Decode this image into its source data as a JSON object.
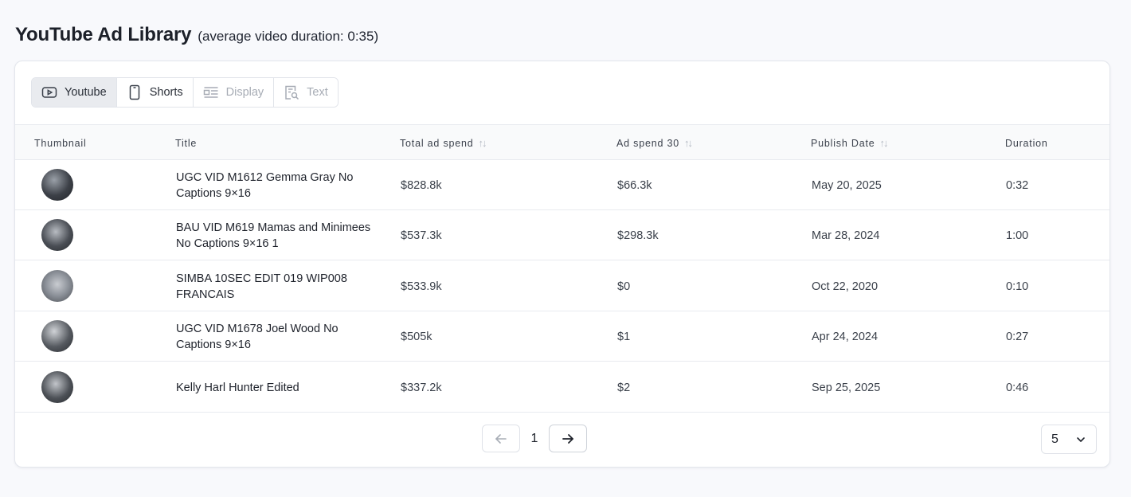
{
  "page": {
    "title": "YouTube Ad Library",
    "subtitle": "(average video duration: 0:35)"
  },
  "tabs": [
    {
      "label": "Youtube",
      "icon": "play-icon",
      "state": "active"
    },
    {
      "label": "Shorts",
      "icon": "phone-icon",
      "state": "normal"
    },
    {
      "label": "Display",
      "icon": "display-icon",
      "state": "disabled"
    },
    {
      "label": "Text",
      "icon": "text-search-icon",
      "state": "disabled"
    }
  ],
  "columns": {
    "thumbnail": "Thumbnail",
    "title": "Title",
    "total_spend": "Total ad spend",
    "spend_30": "Ad spend 30",
    "publish_date": "Publish Date",
    "duration": "Duration"
  },
  "rows": [
    {
      "title": "UGC VID M1612 Gemma Gray No Captions 9×16",
      "total_spend": "$828.8k",
      "spend_30": "$66.3k",
      "publish_date": "May 20, 2025",
      "duration": "0:32",
      "thumb_color": "#3c4047"
    },
    {
      "title": "BAU VID M619 Mamas and Minimees No Captions 9×16 1",
      "total_spend": "$537.3k",
      "spend_30": "$298.3k",
      "publish_date": "Mar 28, 2024",
      "duration": "1:00",
      "thumb_color": "#4a4e55"
    },
    {
      "title": "SIMBA 10SEC EDIT 019 WIP008 FRANCAIS",
      "total_spend": "$533.9k",
      "spend_30": "$0",
      "publish_date": "Oct 22, 2020",
      "duration": "0:10",
      "thumb_color": "#8a8f97"
    },
    {
      "title": "UGC VID M1678 Joel Wood No Captions 9×16",
      "total_spend": "$505k",
      "spend_30": "$1",
      "publish_date": "Apr 24, 2024",
      "duration": "0:27",
      "thumb_color": "#55595f"
    },
    {
      "title": "Kelly Harl Hunter Edited",
      "total_spend": "$337.2k",
      "spend_30": "$2",
      "publish_date": "Sep 25, 2025",
      "duration": "0:46",
      "thumb_color": "#4d5157"
    }
  ],
  "pagination": {
    "current_page": "1",
    "page_size": "5"
  }
}
